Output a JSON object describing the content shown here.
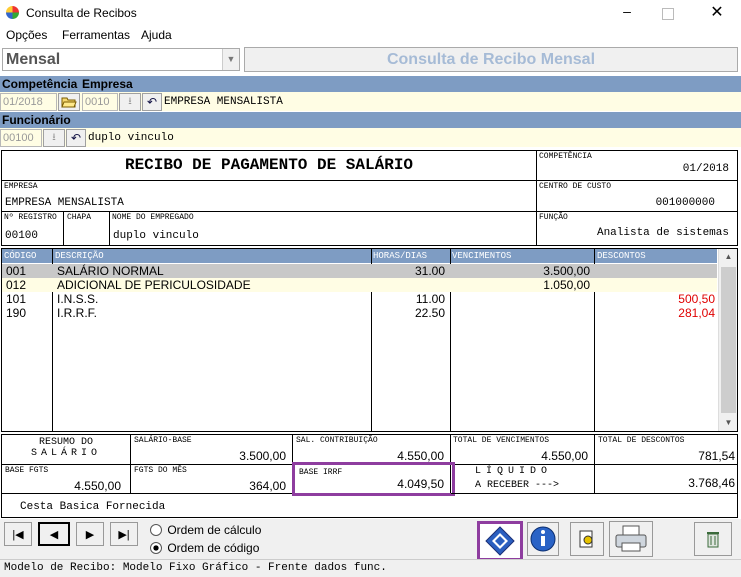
{
  "window": {
    "title": "Consulta de Recibos"
  },
  "menu": [
    "Opções",
    "Ferramentas",
    "Ajuda"
  ],
  "mode_select": "Mensal",
  "panel_title": "Consulta de Recibo Mensal",
  "filters": {
    "competencia_label": "Competência",
    "empresa_label": "Empresa",
    "competencia_value": "01/2018",
    "empresa_code": "0010",
    "empresa_name": "EMPRESA MENSALISTA",
    "funcionario_label": "Funcionário",
    "funcionario_code": "00100",
    "funcionario_name": "duplo vinculo"
  },
  "receipt": {
    "title": "RECIBO DE PAGAMENTO DE SALÁRIO",
    "competencia_label": "COMPETÊNCIA",
    "competencia_value": "01/2018",
    "empresa_label": "EMPRESA",
    "empresa_value": "EMPRESA MENSALISTA",
    "centro_label": "CENTRO DE CUSTO",
    "centro_value": "001000000",
    "registro_label": "Nº REGISTRO",
    "registro_value": "00100",
    "chapa_label": "CHAPA",
    "nome_label": "NOME DO EMPREGADO",
    "nome_value": "duplo vinculo",
    "funcao_label": "FUNÇÃO",
    "funcao_value": "Analista de sistemas"
  },
  "grid": {
    "headers": [
      "CÓDIGO",
      "DESCRIÇÃO",
      "HORAS/DIAS",
      "VENCIMENTOS",
      "DESCONTOS"
    ],
    "rows": [
      {
        "codigo": "001",
        "descricao": "SALÁRIO NORMAL",
        "horas": "31.00",
        "venc": "3.500,00",
        "desc": ""
      },
      {
        "codigo": "012",
        "descricao": "ADICIONAL DE PERICULOSIDADE",
        "horas": "",
        "venc": "1.050,00",
        "desc": ""
      },
      {
        "codigo": "101",
        "descricao": "I.N.S.S.",
        "horas": "11.00",
        "venc": "",
        "desc": "500,50"
      },
      {
        "codigo": "190",
        "descricao": "I.R.R.F.",
        "horas": "22.50",
        "venc": "",
        "desc": "281,04"
      }
    ]
  },
  "summary": {
    "resumo_line1": "RESUMO DO",
    "resumo_line2": "SALÁRIO",
    "salario_base_label": "SALÁRIO-BASE",
    "salario_base_value": "3.500,00",
    "sal_contrib_label": "SAL. CONTRIBUIÇÃO",
    "sal_contrib_value": "4.550,00",
    "total_venc_label": "TOTAL DE VENCIMENTOS",
    "total_venc_value": "4.550,00",
    "total_desc_label": "TOTAL DE DESCONTOS",
    "total_desc_value": "781,54",
    "base_fgts_label": "BASE FGTS",
    "base_fgts_value": "4.550,00",
    "fgts_mes_label": "FGTS DO MÊS",
    "fgts_mes_value": "364,00",
    "base_irrf_label": "BASE IRRF",
    "base_irrf_value": "4.049,50",
    "liquido_line1": "LÍQUIDO",
    "liquido_line2": "A RECEBER --->",
    "liquido_value": "3.768,46",
    "obs": "Cesta Basica Fornecida"
  },
  "order": {
    "option1": "Ordem de cálculo",
    "option2": "Ordem de código",
    "selected": "Ordem de código"
  },
  "status": "Modelo de Recibo: Modelo Fixo Gráfico - Frente dados func.",
  "colors": {
    "header_blue": "#7e9cc3",
    "field_yellow": "#fffde4",
    "highlight_purple": "#8e3d9f",
    "negative_red": "#e00000"
  }
}
